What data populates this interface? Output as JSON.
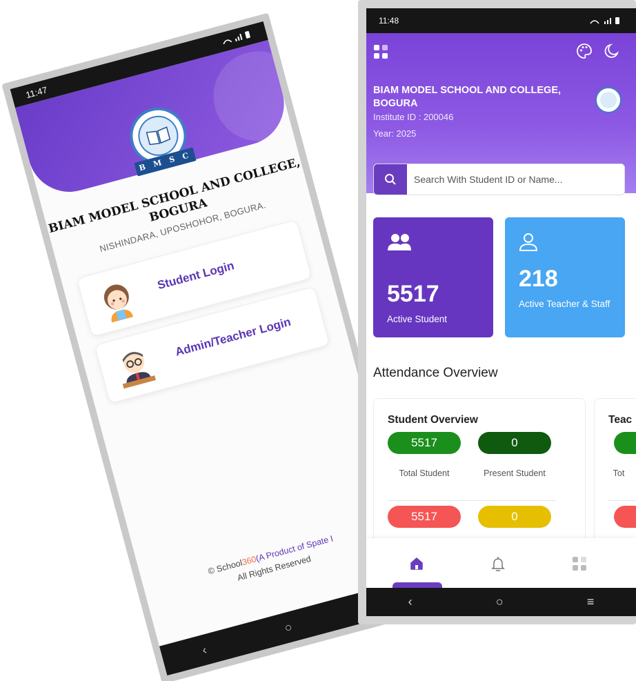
{
  "left_phone": {
    "status_time": "11:47",
    "school_name_line1": "BIAM MODEL SCHOOL AND COLLEGE,",
    "school_name_line2": "BOGURA",
    "address": "NISHINDARA, UPOSHOHOR, BOGURA.",
    "logo_ribbon": "B M S C",
    "student_login_label": "Student Login",
    "admin_login_label": "Admin/Teacher Login",
    "footer_prefix": "© School",
    "footer_accent": "360",
    "footer_product": "(A Product of Spate I",
    "footer_rights": "All Rights Reserved"
  },
  "right_phone": {
    "status_time": "11:48",
    "school_name": "BIAM MODEL SCHOOL AND COLLEGE, BOGURA",
    "institute_id": "Institute ID : 200046",
    "year": "Year: 2025",
    "search_placeholder": "Search With Student ID or Name...",
    "stats": {
      "students_value": "5517",
      "students_label": "Active Student",
      "teachers_value": "218",
      "teachers_label": "Active Teacher & Staff"
    },
    "attendance_title": "Attendance Overview",
    "student_overview": {
      "title": "Student Overview",
      "total": "5517",
      "present": "0",
      "total_label": "Total Student",
      "present_label": "Present Student",
      "absent": "5517",
      "leave": "0"
    },
    "teacher_overview": {
      "title": "Teac",
      "total_label": "Tot"
    }
  },
  "colors": {
    "primary_purple": "#6a3dc0",
    "teacher_blue": "#48a6f2",
    "pill_green": "#1b8f1b",
    "pill_dark_green": "#0f5a0f",
    "pill_red": "#f55555",
    "pill_yellow": "#e6bf00"
  }
}
